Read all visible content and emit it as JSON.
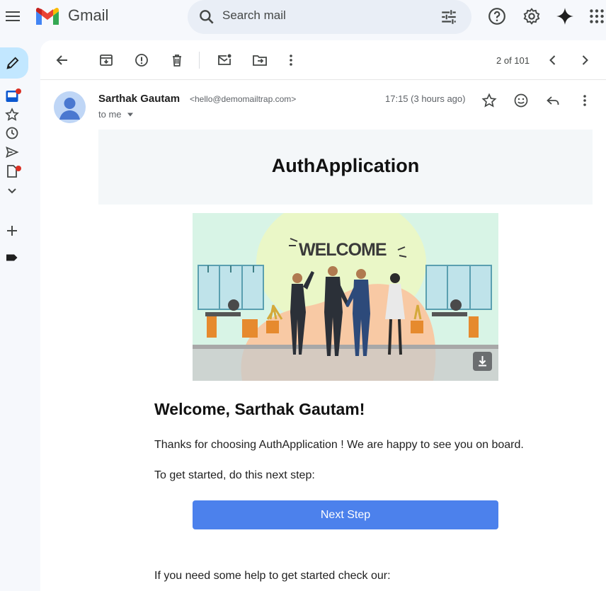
{
  "app": {
    "brand": "Gmail"
  },
  "search": {
    "placeholder": "Search mail"
  },
  "toolbar": {
    "pager": "2 of 101"
  },
  "message": {
    "sender_name": "Sarthak Gautam",
    "sender_email": "<hello@demomailtrap.com>",
    "recipient": "to me",
    "time": "17:15 (3 hours ago)"
  },
  "email_body": {
    "banner_title": "AuthApplication",
    "hero_caption": "WELCOME",
    "greeting": "Welcome, Sarthak Gautam!",
    "thanks": "Thanks for choosing AuthApplication ! We are happy to see you on board.",
    "get_started": "To get started, do this next step:",
    "cta_label": "Next Step",
    "help": "If you need some help to get started check our:"
  },
  "colors": {
    "accent": "#4c81ec",
    "compose_bg": "#c2e7ff",
    "unread_dot": "#d93025"
  },
  "icons": {
    "top": [
      "menu-icon",
      "gmail-logo",
      "search-icon",
      "tune-icon",
      "help-icon",
      "settings-icon",
      "gemini-icon",
      "apps-icon"
    ],
    "rail": [
      "compose-pencil-icon",
      "inbox-icon",
      "star-icon",
      "clock-icon",
      "send-icon",
      "draft-icon",
      "chevron-down-icon",
      "plus-icon",
      "label-icon"
    ],
    "toolbar": [
      "back-arrow-icon",
      "archive-icon",
      "report-spam-icon",
      "delete-icon",
      "mark-unread-icon",
      "move-to-icon",
      "more-vert-icon",
      "chevron-left-icon",
      "chevron-right-icon"
    ],
    "header": [
      "star-icon",
      "emoji-icon",
      "reply-icon",
      "more-vert-icon"
    ]
  }
}
